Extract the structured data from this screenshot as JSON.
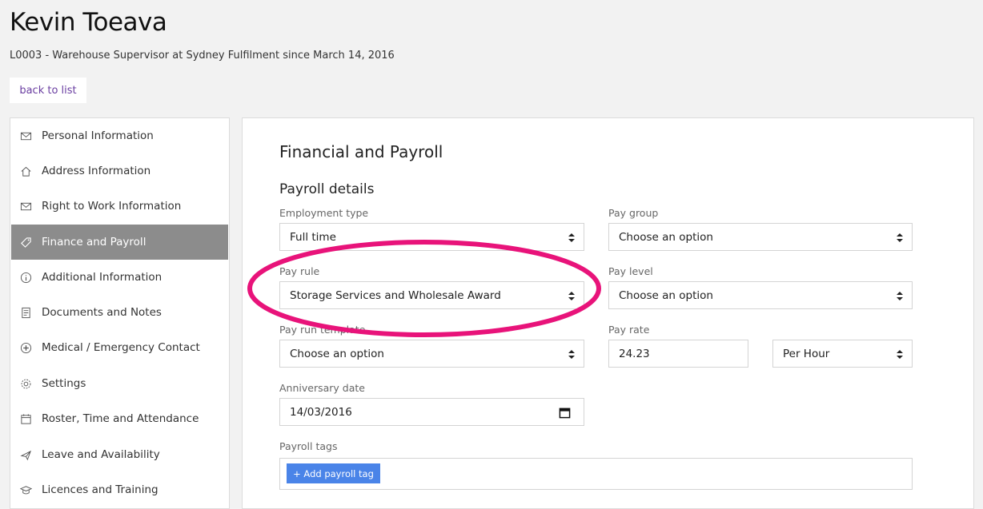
{
  "header": {
    "name": "Kevin Toeava",
    "subtitle": "L0003 - Warehouse Supervisor at Sydney Fulfilment since March 14, 2016",
    "back_label": "back to list"
  },
  "sidebar": {
    "items": [
      {
        "label": "Personal Information",
        "icon": "envelope-icon"
      },
      {
        "label": "Address Information",
        "icon": "home-icon"
      },
      {
        "label": "Right to Work Information",
        "icon": "envelope-icon"
      },
      {
        "label": "Finance and Payroll",
        "icon": "tag-icon",
        "active": true
      },
      {
        "label": "Additional Information",
        "icon": "info-icon"
      },
      {
        "label": "Documents and Notes",
        "icon": "document-icon"
      },
      {
        "label": "Medical / Emergency Contact",
        "icon": "medical-plus-icon"
      },
      {
        "label": "Settings",
        "icon": "gear-icon"
      },
      {
        "label": "Roster, Time and Attendance",
        "icon": "calendar-icon"
      },
      {
        "label": "Leave and Availability",
        "icon": "plane-icon"
      },
      {
        "label": "Licences and Training",
        "icon": "graduation-icon"
      }
    ]
  },
  "main": {
    "title": "Financial and Payroll",
    "section": "Payroll details",
    "employment_type": {
      "label": "Employment type",
      "value": "Full time"
    },
    "pay_group": {
      "label": "Pay group",
      "value": "Choose an option"
    },
    "pay_rule": {
      "label": "Pay rule",
      "value": "Storage Services and Wholesale Award"
    },
    "pay_level": {
      "label": "Pay level",
      "value": "Choose an option"
    },
    "pay_run_template": {
      "label": "Pay run template",
      "value": "Choose an option"
    },
    "pay_rate": {
      "label": "Pay rate",
      "value": "24.23",
      "unit": "Per Hour"
    },
    "anniversary_date": {
      "label": "Anniversary date",
      "value": "14/03/2016"
    },
    "payroll_tags": {
      "label": "Payroll tags",
      "add_label": "+ Add payroll tag"
    }
  },
  "colors": {
    "accent_link": "#6a3ea1",
    "active_sidebar": "#8c8c8c",
    "tag_button": "#4a84e8",
    "highlight_oval": "#e8137a"
  }
}
